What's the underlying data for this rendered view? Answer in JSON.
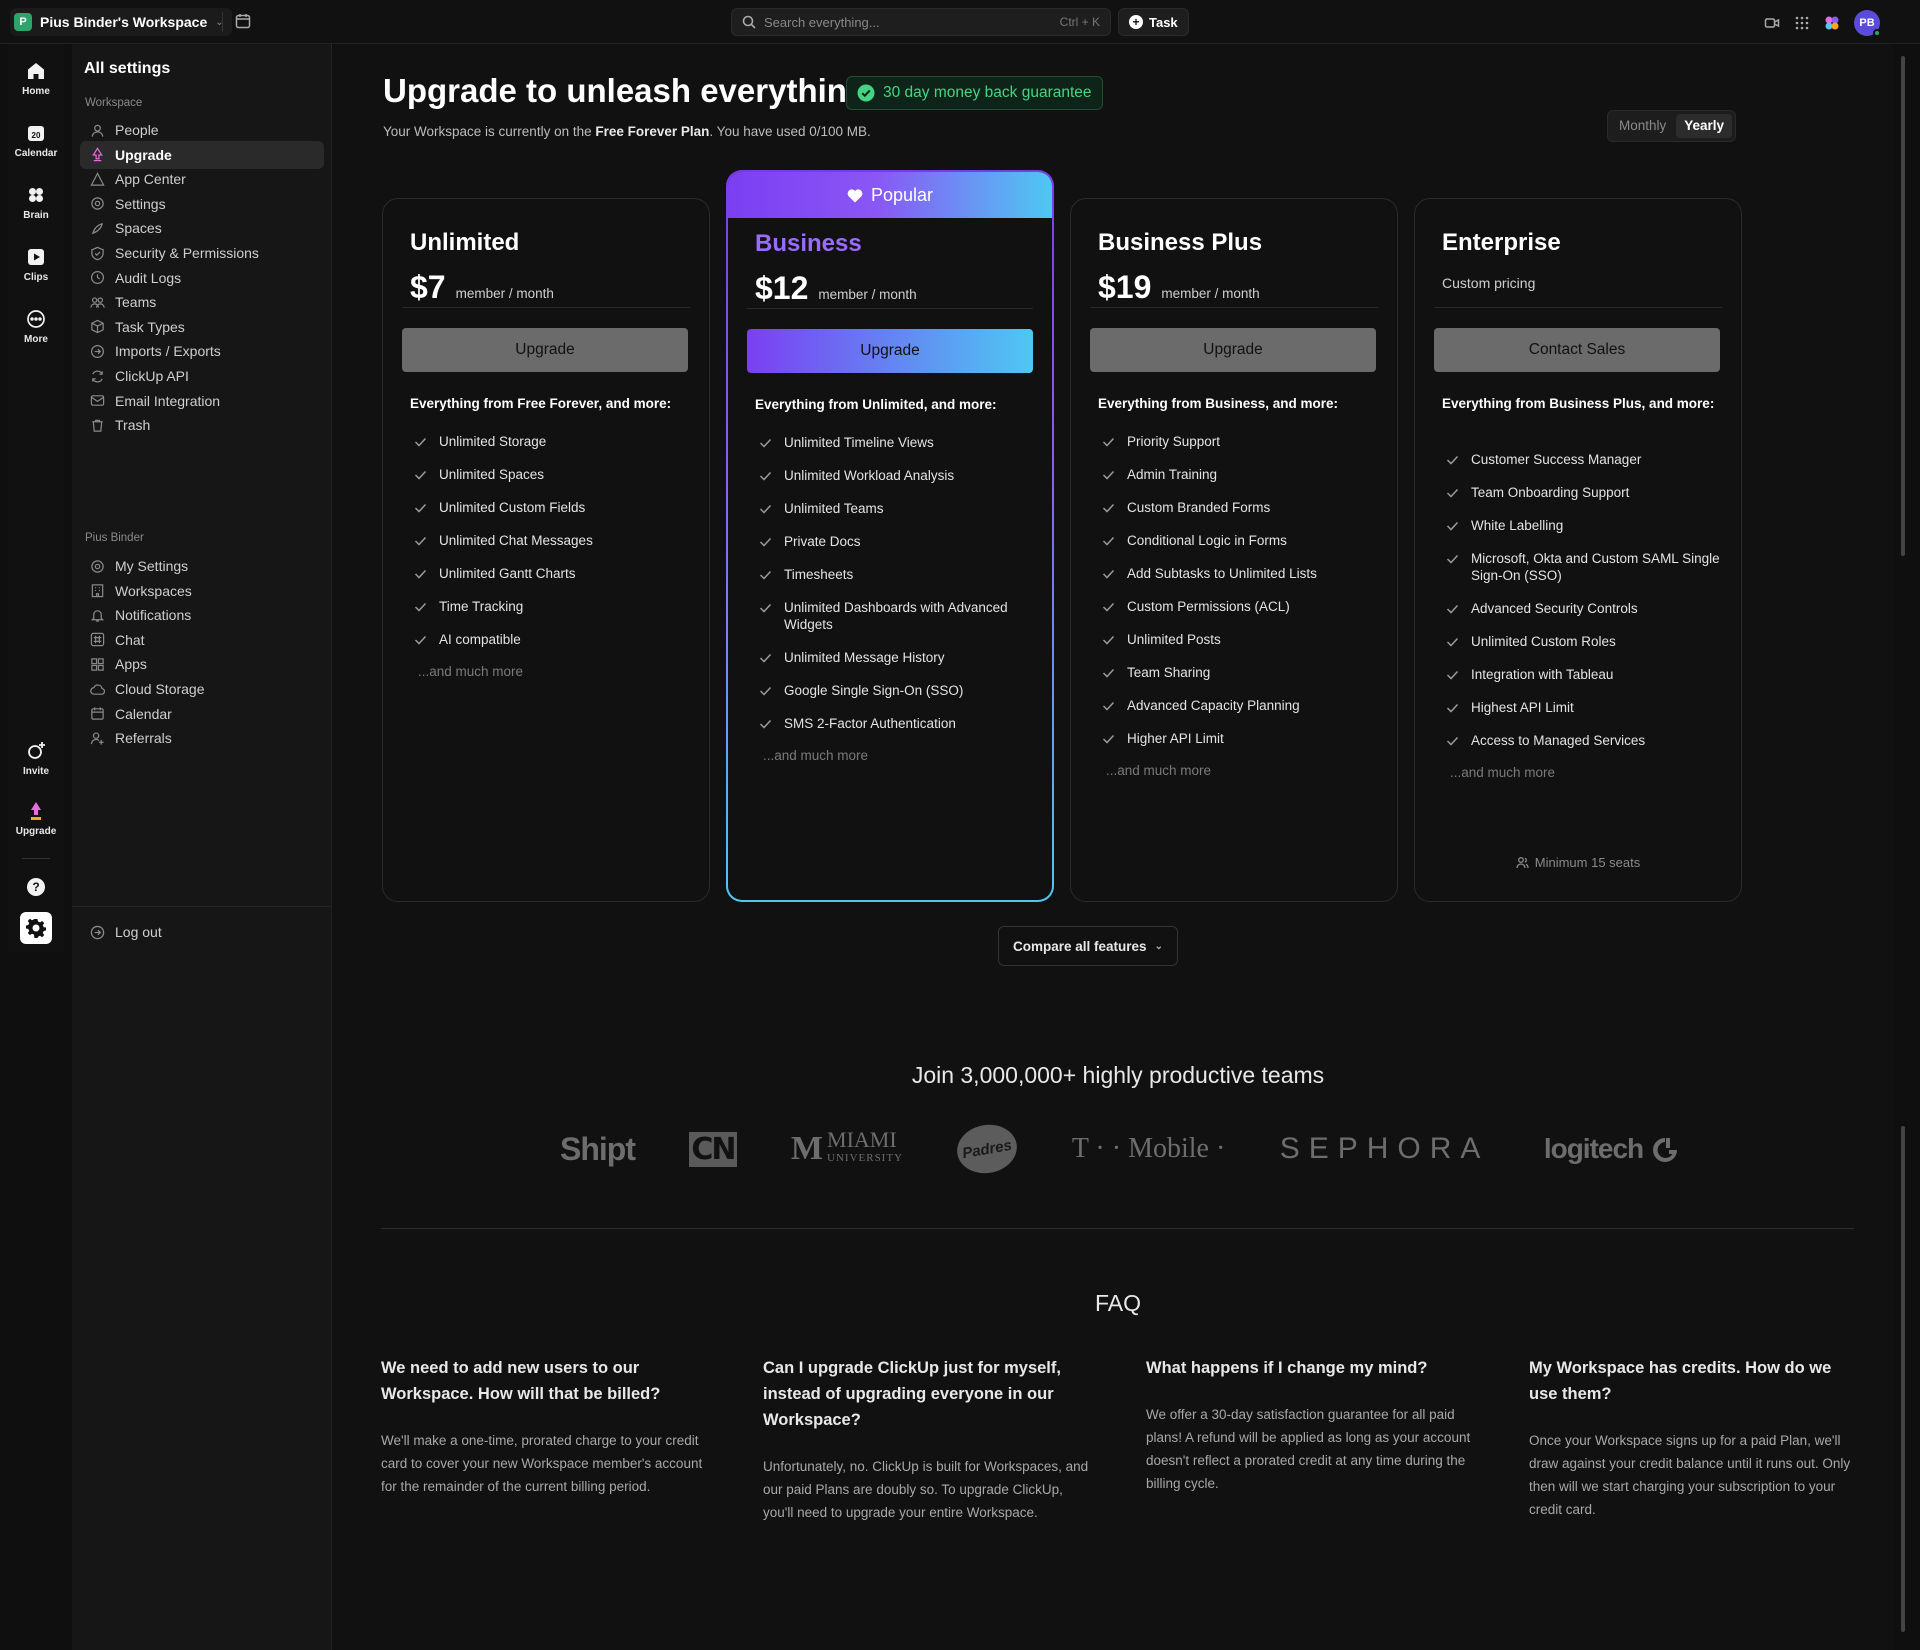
{
  "topbar": {
    "workspace_initial": "P",
    "workspace_name": "Pius Binder's Workspace",
    "search_placeholder": "Search everything...",
    "search_shortcut": "Ctrl + K",
    "task_label": "Task",
    "avatar_initials": "PB"
  },
  "rail": {
    "home": "Home",
    "calendar": "Calendar",
    "calendar_day": "20",
    "brain": "Brain",
    "clips": "Clips",
    "more": "More",
    "invite": "Invite",
    "upgrade": "Upgrade"
  },
  "sidebar": {
    "title": "All settings",
    "workspace_section": "Workspace",
    "workspace_items": [
      {
        "label": "People",
        "icon": "person-icon"
      },
      {
        "label": "Upgrade",
        "icon": "upgrade-icon",
        "active": true
      },
      {
        "label": "App Center",
        "icon": "app-center-icon"
      },
      {
        "label": "Settings",
        "icon": "gear-icon"
      },
      {
        "label": "Spaces",
        "icon": "spaces-icon"
      },
      {
        "label": "Security & Permissions",
        "icon": "shield-icon"
      },
      {
        "label": "Audit Logs",
        "icon": "clock-icon"
      },
      {
        "label": "Teams",
        "icon": "teams-icon"
      },
      {
        "label": "Task Types",
        "icon": "cube-icon"
      },
      {
        "label": "Imports / Exports",
        "icon": "import-icon"
      },
      {
        "label": "ClickUp API",
        "icon": "api-icon"
      },
      {
        "label": "Email Integration",
        "icon": "mail-icon"
      },
      {
        "label": "Trash",
        "icon": "trash-icon"
      }
    ],
    "user_section": "Pius Binder",
    "user_items": [
      {
        "label": "My Settings",
        "icon": "gear-icon"
      },
      {
        "label": "Workspaces",
        "icon": "building-icon"
      },
      {
        "label": "Notifications",
        "icon": "bell-icon"
      },
      {
        "label": "Chat",
        "icon": "hash-icon"
      },
      {
        "label": "Apps",
        "icon": "apps-icon"
      },
      {
        "label": "Cloud Storage",
        "icon": "cloud-icon"
      },
      {
        "label": "Calendar",
        "icon": "calendar-icon"
      },
      {
        "label": "Referrals",
        "icon": "referral-icon"
      }
    ],
    "logout": "Log out"
  },
  "main": {
    "title": "Upgrade to unleash everything",
    "guarantee": "30 day money back guarantee",
    "plan_note_prefix": "Your Workspace is currently on the ",
    "plan_note_plan": "Free Forever Plan",
    "plan_note_suffix": ". You have used 0/100 MB.",
    "billing": {
      "monthly": "Monthly",
      "yearly": "Yearly",
      "selected": "Yearly"
    },
    "popular_label": "Popular",
    "plans": [
      {
        "name": "Unlimited",
        "price": "$7",
        "unit": "member / month",
        "button": "Upgrade",
        "lead": "Everything from Free Forever, and more:",
        "features": [
          "Unlimited Storage",
          "Unlimited Spaces",
          "Unlimited Custom Fields",
          "Unlimited Chat Messages",
          "Unlimited Gantt Charts",
          "Time Tracking",
          "AI compatible"
        ],
        "more": "...and much more"
      },
      {
        "name": "Business",
        "price": "$12",
        "unit": "member / month",
        "button": "Upgrade",
        "lead": "Everything from Unlimited, and more:",
        "features": [
          "Unlimited Timeline Views",
          "Unlimited Workload Analysis",
          "Unlimited Teams",
          "Private Docs",
          "Timesheets",
          "Unlimited Dashboards with Advanced Widgets",
          "Unlimited Message History",
          "Google Single Sign-On (SSO)",
          "SMS 2-Factor Authentication"
        ],
        "more": "...and much more"
      },
      {
        "name": "Business Plus",
        "price": "$19",
        "unit": "member / month",
        "button": "Upgrade",
        "lead": "Everything from Business, and more:",
        "features": [
          "Priority Support",
          "Admin Training",
          "Custom Branded Forms",
          "Conditional Logic in Forms",
          "Add Subtasks to Unlimited Lists",
          "Custom Permissions (ACL)",
          "Unlimited Posts",
          "Team Sharing",
          "Advanced Capacity Planning",
          "Higher API Limit"
        ],
        "more": "...and much more"
      },
      {
        "name": "Enterprise",
        "pricing_text": "Custom pricing",
        "button": "Contact Sales",
        "lead": "Everything from Business Plus, and more:",
        "features": [
          "Customer Success Manager",
          "Team Onboarding Support",
          "White Labelling",
          "Microsoft, Okta and Custom SAML Single Sign-On (SSO)",
          "Advanced Security Controls",
          "Unlimited Custom Roles",
          "Integration with Tableau",
          "Highest API Limit",
          "Access to Managed Services"
        ],
        "more": "...and much more",
        "min_seats": "Minimum 15 seats"
      }
    ],
    "compare": "Compare all features",
    "join_title": "Join 3,000,000+ highly productive teams",
    "logos": {
      "shipt": "Shipt",
      "cn": "CN",
      "miami_m": "M",
      "miami_name": "MIAMI",
      "miami_sub": "UNIVERSITY",
      "padres": "Padres",
      "tmobile": "T · · Mobile ·",
      "sephora": "SEPHORA",
      "logitech": "logitech"
    },
    "faq_title": "FAQ",
    "faq": [
      {
        "q": "We need to add new users to our Workspace. How will that be billed?",
        "a": "We'll make a one-time, prorated charge to your credit card to cover your new Workspace member's account for the remainder of the current billing period."
      },
      {
        "q": "Can I upgrade ClickUp just for myself, instead of upgrading everyone in our Workspace?",
        "a": "Unfortunately, no. ClickUp is built for Workspaces, and our paid Plans are doubly so. To upgrade ClickUp, you'll need to upgrade your entire Workspace."
      },
      {
        "q": "What happens if I change my mind?",
        "a": "We offer a 30-day satisfaction guarantee for all paid plans! A refund will be applied as long as your account doesn't reflect a prorated credit at any time during the billing cycle."
      },
      {
        "q": "My Workspace has credits. How do we use them?",
        "a": "Once your Workspace signs up for a paid Plan, we'll draw against your credit balance until it runs out. Only then will we start charging your subscription to your credit card."
      }
    ]
  }
}
